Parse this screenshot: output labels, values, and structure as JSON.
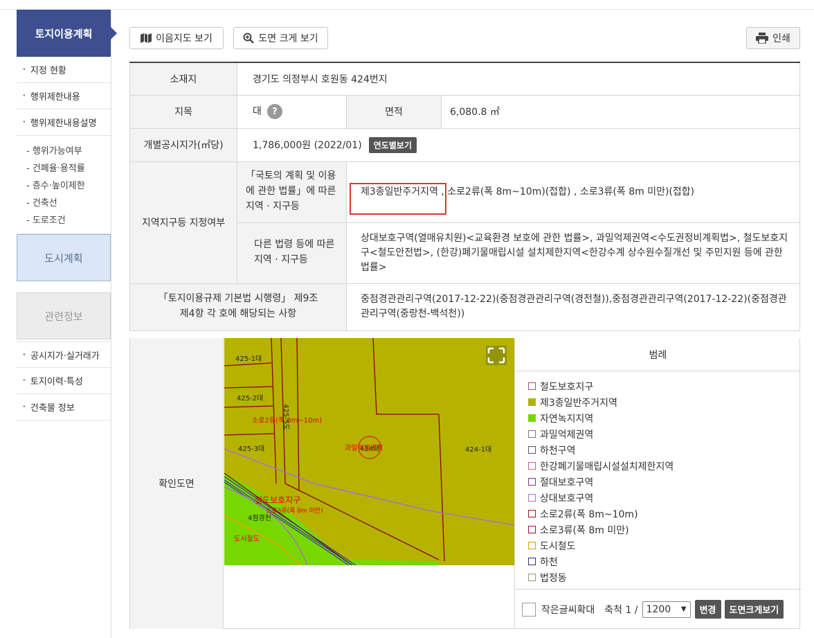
{
  "sidebar": {
    "title": "토지이용계획",
    "items": [
      "지정 현황",
      "행위제한내용",
      "행위제한내용설명"
    ],
    "subitems": [
      "- 행위가능여부",
      "- 건폐율·용적률",
      "- 층수·높이제한",
      "- 건축선",
      "- 도로조건"
    ],
    "box_city": "도시계획",
    "box_related": "관련정보",
    "bottom_items": [
      "공시지가·실거래가",
      "토지이력·특성",
      "건축물 정보"
    ]
  },
  "toolbar": {
    "map_btn": "이음지도 보기",
    "zoom_btn": "도면 크게 보기",
    "print_btn": "인쇄"
  },
  "info": {
    "location_label": "소재지",
    "location_value": "경기도 의정부시 호원동 424번지",
    "jimok_label": "지목",
    "jimok_value": "대",
    "jimok_help": "?",
    "area_label": "면적",
    "area_value": "6,080.8 ㎡",
    "price_label": "개별공시지가(㎡당)",
    "price_value": "1,786,000원 (2022/01)",
    "price_btn": "연도별보기",
    "zone_label": "지역지구등 지정여부",
    "zone1_label": "「국토의 계획 및 이용에 관한 법률」에 따른 지역 · 지구등",
    "zone1_value": "제3종일반주거지역 , 소로2류(폭 8m~10m)(접합) , 소로3류(폭 8m 미만)(접합)",
    "zone2_label": "다른 법령 등에 따른 지역 · 지구등",
    "zone2_value": "상대보호구역(열매유치원)<교육환경 보호에 관한 법률>, 과밀억제권역<수도권정비계획법>, 철도보호지구<철도안전법>, (한강)폐기물매립시설 설치제한지역<한강수계 상수원수질개선 및 주민지원 등에 관한 법률>",
    "reg_label": "「토지이용규제 기본법 시행령」 제9조 제4항 각 호에 해당되는 사항",
    "reg_value": "중점경관관리구역(2017-12-22)(중점경관관리구역(경전철)),중점경관관리구역(2017-12-22)(중점경관관리구역(중랑천-백석천))",
    "map_label": "확인도면"
  },
  "map": {
    "labels": [
      "425-1대",
      "425-2대",
      "소로2류(폭 8m~10m)",
      "425-5도",
      "425-3대",
      "과밀억제권역",
      "424대",
      "424-1대",
      "철도보호지구",
      "소로3류(폭 8m 미만)",
      "4점경천",
      "도시철도"
    ],
    "colors": {
      "zone": "#b5b300",
      "green": "#77d800",
      "road": "#8b0000"
    }
  },
  "legend": {
    "title": "범례",
    "items": [
      {
        "label": "철도보호지구",
        "color": "#a0508c"
      },
      {
        "label": "제3종일반주거지역",
        "color": "#b5b300"
      },
      {
        "label": "자연녹지지역",
        "color": "#77d800"
      },
      {
        "label": "과밀억제권역",
        "color": "#777777"
      },
      {
        "label": "하천구역",
        "color": "#555577"
      },
      {
        "label": "한강폐기물매립시설설치제한지역",
        "color": "#c06090"
      },
      {
        "label": "절대보호구역",
        "color": "#8a2a8a"
      },
      {
        "label": "상대보호구역",
        "color": "#b070c0"
      },
      {
        "label": "소로2류(폭 8m~10m)",
        "color": "#8b1a1a"
      },
      {
        "label": "소로3류(폭 8m 미만)",
        "color": "#a01030"
      },
      {
        "label": "도시철도",
        "color": "#d4a000"
      },
      {
        "label": "하천",
        "color": "#2a2a8a"
      },
      {
        "label": "법정동",
        "color": "#9a9a70"
      }
    ],
    "fontzoom": "작은글씨확대",
    "scale_label": "축척 1 /",
    "scale_value": "1200",
    "change_btn": "변경",
    "bigmap_btn": "도면크게보기"
  }
}
